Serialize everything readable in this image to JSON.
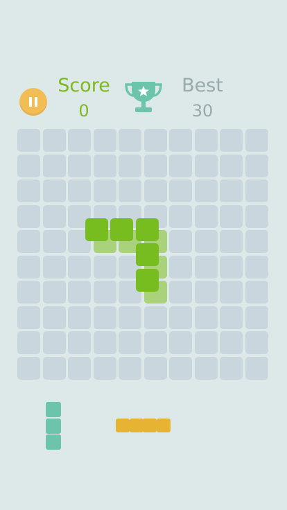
{
  "header": {
    "score_label": "Score",
    "score_value": "0",
    "best_label": "Best",
    "best_value": "30"
  },
  "board": {
    "rows": 10,
    "cols": 10,
    "empty_color": "#cad6de",
    "ghost_color": "#a9d27a",
    "piece_color": "#77bd1f",
    "ghost_cells": [
      [
        4,
        3
      ],
      [
        4,
        4
      ],
      [
        4,
        5
      ],
      [
        5,
        5
      ],
      [
        6,
        5
      ]
    ],
    "piece_cells": [
      [
        3,
        3
      ],
      [
        3,
        4
      ],
      [
        3,
        5
      ],
      [
        4,
        5
      ],
      [
        5,
        5
      ]
    ]
  },
  "tray": {
    "pieces": [
      {
        "name": "tray-piece-vertical-3",
        "color": "#6cc4ad",
        "cells": [
          [
            0,
            0
          ],
          [
            1,
            0
          ],
          [
            2,
            0
          ]
        ]
      },
      {
        "name": "tray-piece-horizontal-4",
        "color": "#e6b332",
        "cells": [
          [
            0,
            0
          ],
          [
            0,
            1
          ],
          [
            0,
            2
          ],
          [
            0,
            3
          ]
        ]
      }
    ]
  },
  "icons": {
    "pause": "pause-icon",
    "trophy": "trophy-icon"
  },
  "colors": {
    "background": "#dde9e9",
    "score": "#7dba1e",
    "best": "#9aa9ad",
    "pause": "#f2bd55",
    "trophy": "#6cc4ad"
  }
}
